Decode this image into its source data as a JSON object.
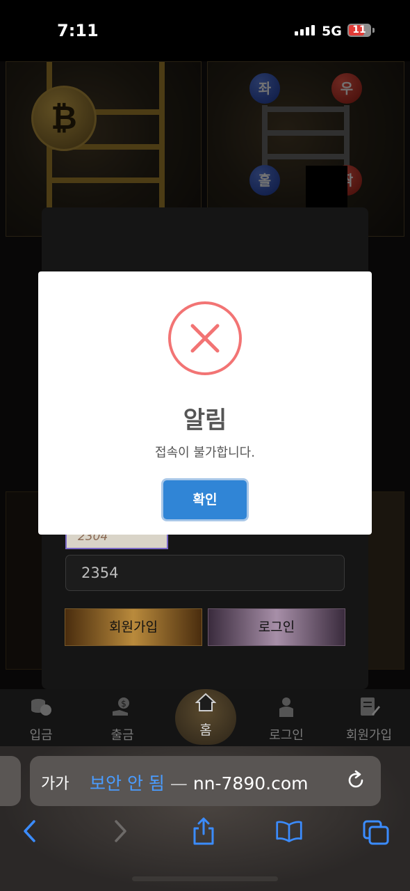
{
  "status_bar": {
    "time": "7:11",
    "network": "5G",
    "battery": "11"
  },
  "background": {
    "coin_symbol": "₿",
    "balls": [
      "좌",
      "우",
      "홀",
      "짝"
    ]
  },
  "login": {
    "yellow_input_value": "2304",
    "password_value": "2354",
    "join_button": "회원가입",
    "login_button": "로그인"
  },
  "bottom_nav": {
    "items": [
      {
        "label": "입금",
        "icon": "coins-icon"
      },
      {
        "label": "출금",
        "icon": "money-hand-icon"
      },
      {
        "label": "홈",
        "icon": "home-icon"
      },
      {
        "label": "로그인",
        "icon": "user-icon"
      },
      {
        "label": "회원가입",
        "icon": "signup-icon"
      }
    ]
  },
  "alert": {
    "icon": "error-x-icon",
    "title": "알림",
    "message": "접속이 불가합니다.",
    "confirm_button": "확인",
    "accent_color": "#3085d6",
    "error_color": "#f27474"
  },
  "browser": {
    "text_size_label": "가가",
    "security_label": "보안 안 됨",
    "separator": " — ",
    "domain": "nn-7890.com"
  }
}
